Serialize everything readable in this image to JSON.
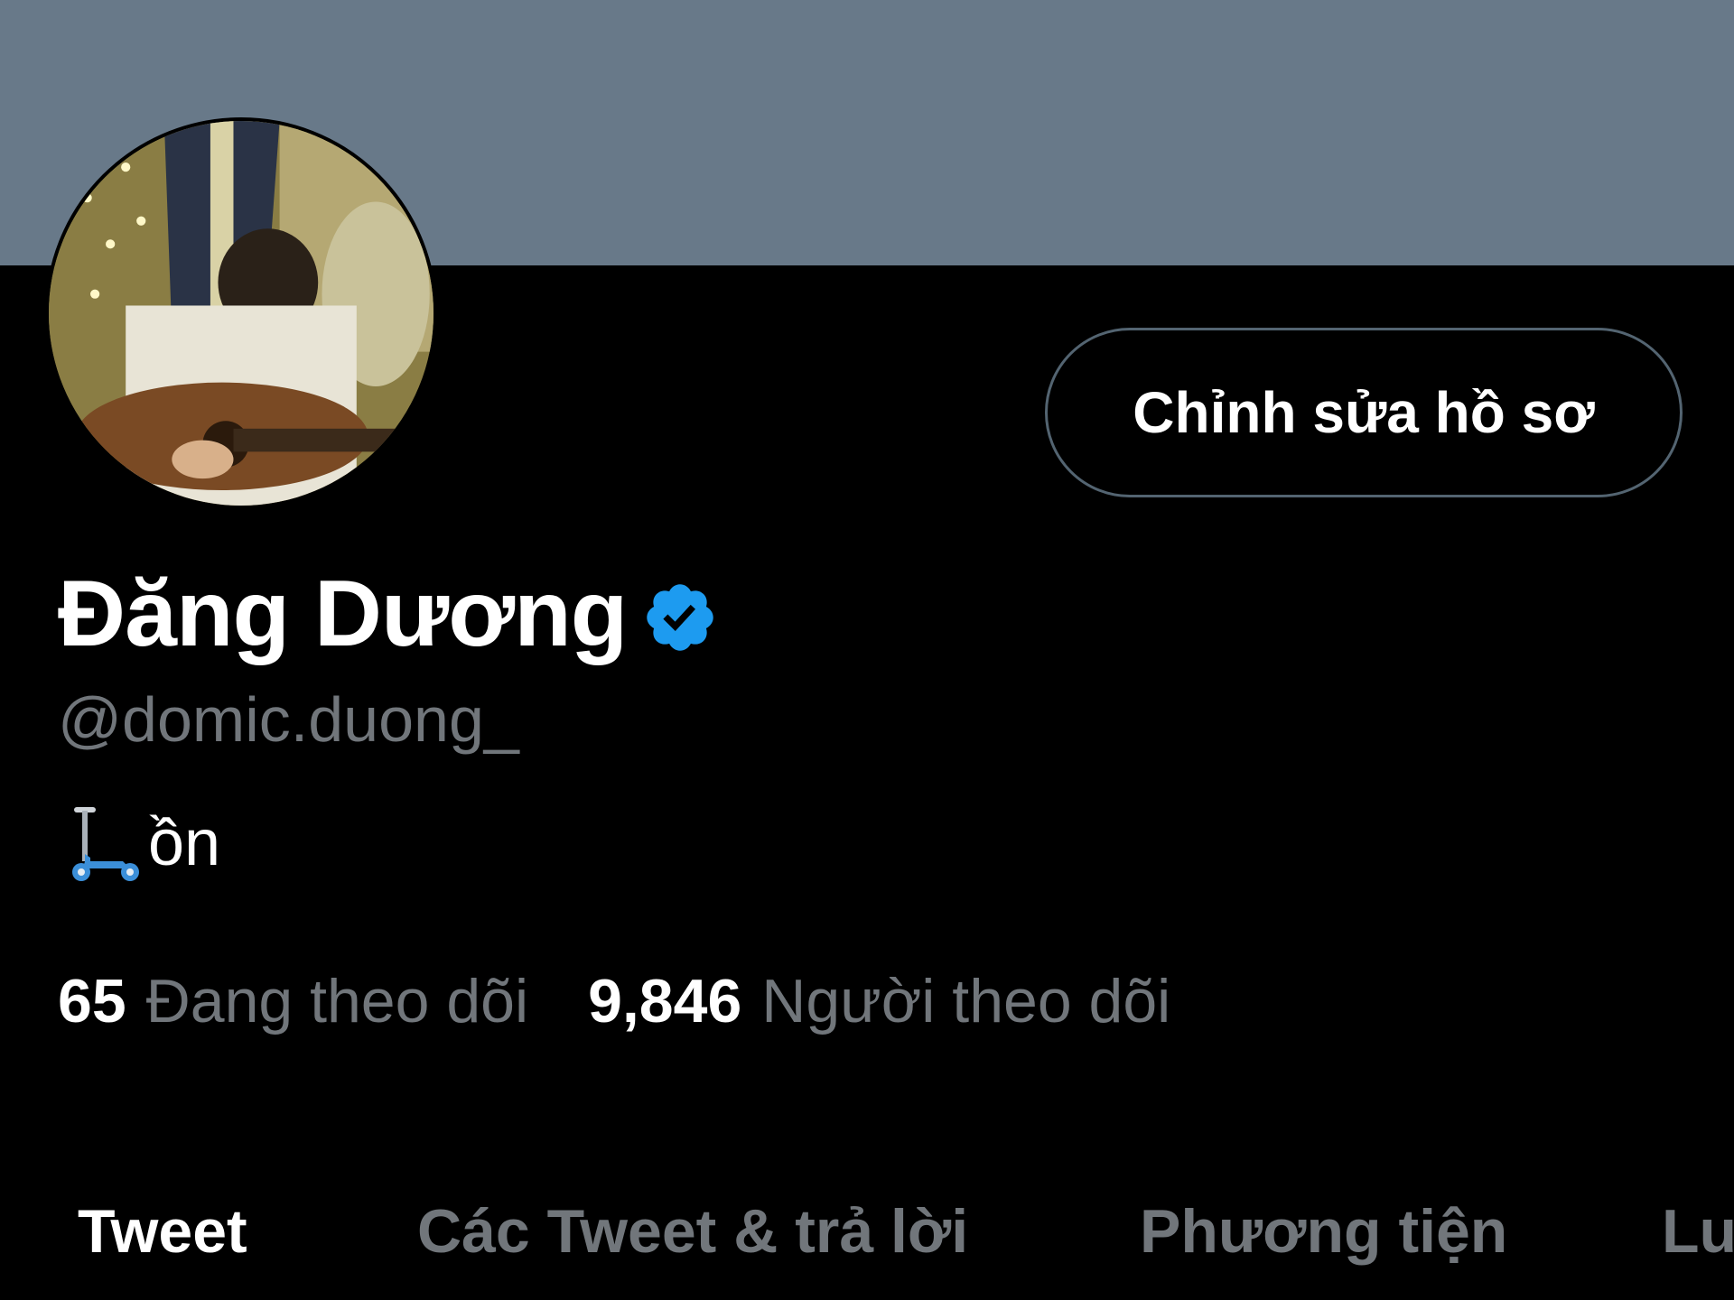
{
  "profile": {
    "edit_button_label": "Chỉnh sửa hồ sơ",
    "display_name": "Đăng Dương",
    "handle": "@domic.duong_",
    "bio_text": "ồn",
    "bio_icon": "kick-scooter-icon",
    "verified_icon": "verified-badge-icon",
    "avatar_icon": "profile-photo"
  },
  "stats": {
    "following_count": "65",
    "following_label": "Đang theo dõi",
    "followers_count": "9,846",
    "followers_label": "Người theo dõi"
  },
  "tabs": [
    {
      "label": "Tweet",
      "active": true
    },
    {
      "label": "Các Tweet & trả lời",
      "active": false
    },
    {
      "label": "Phương tiện",
      "active": false
    },
    {
      "label": "Lu",
      "active": false
    }
  ],
  "colors": {
    "banner": "#687989",
    "background": "#000000",
    "primary_text": "#ffffff",
    "secondary_text": "#71767b",
    "verified": "#1d9bf0"
  }
}
